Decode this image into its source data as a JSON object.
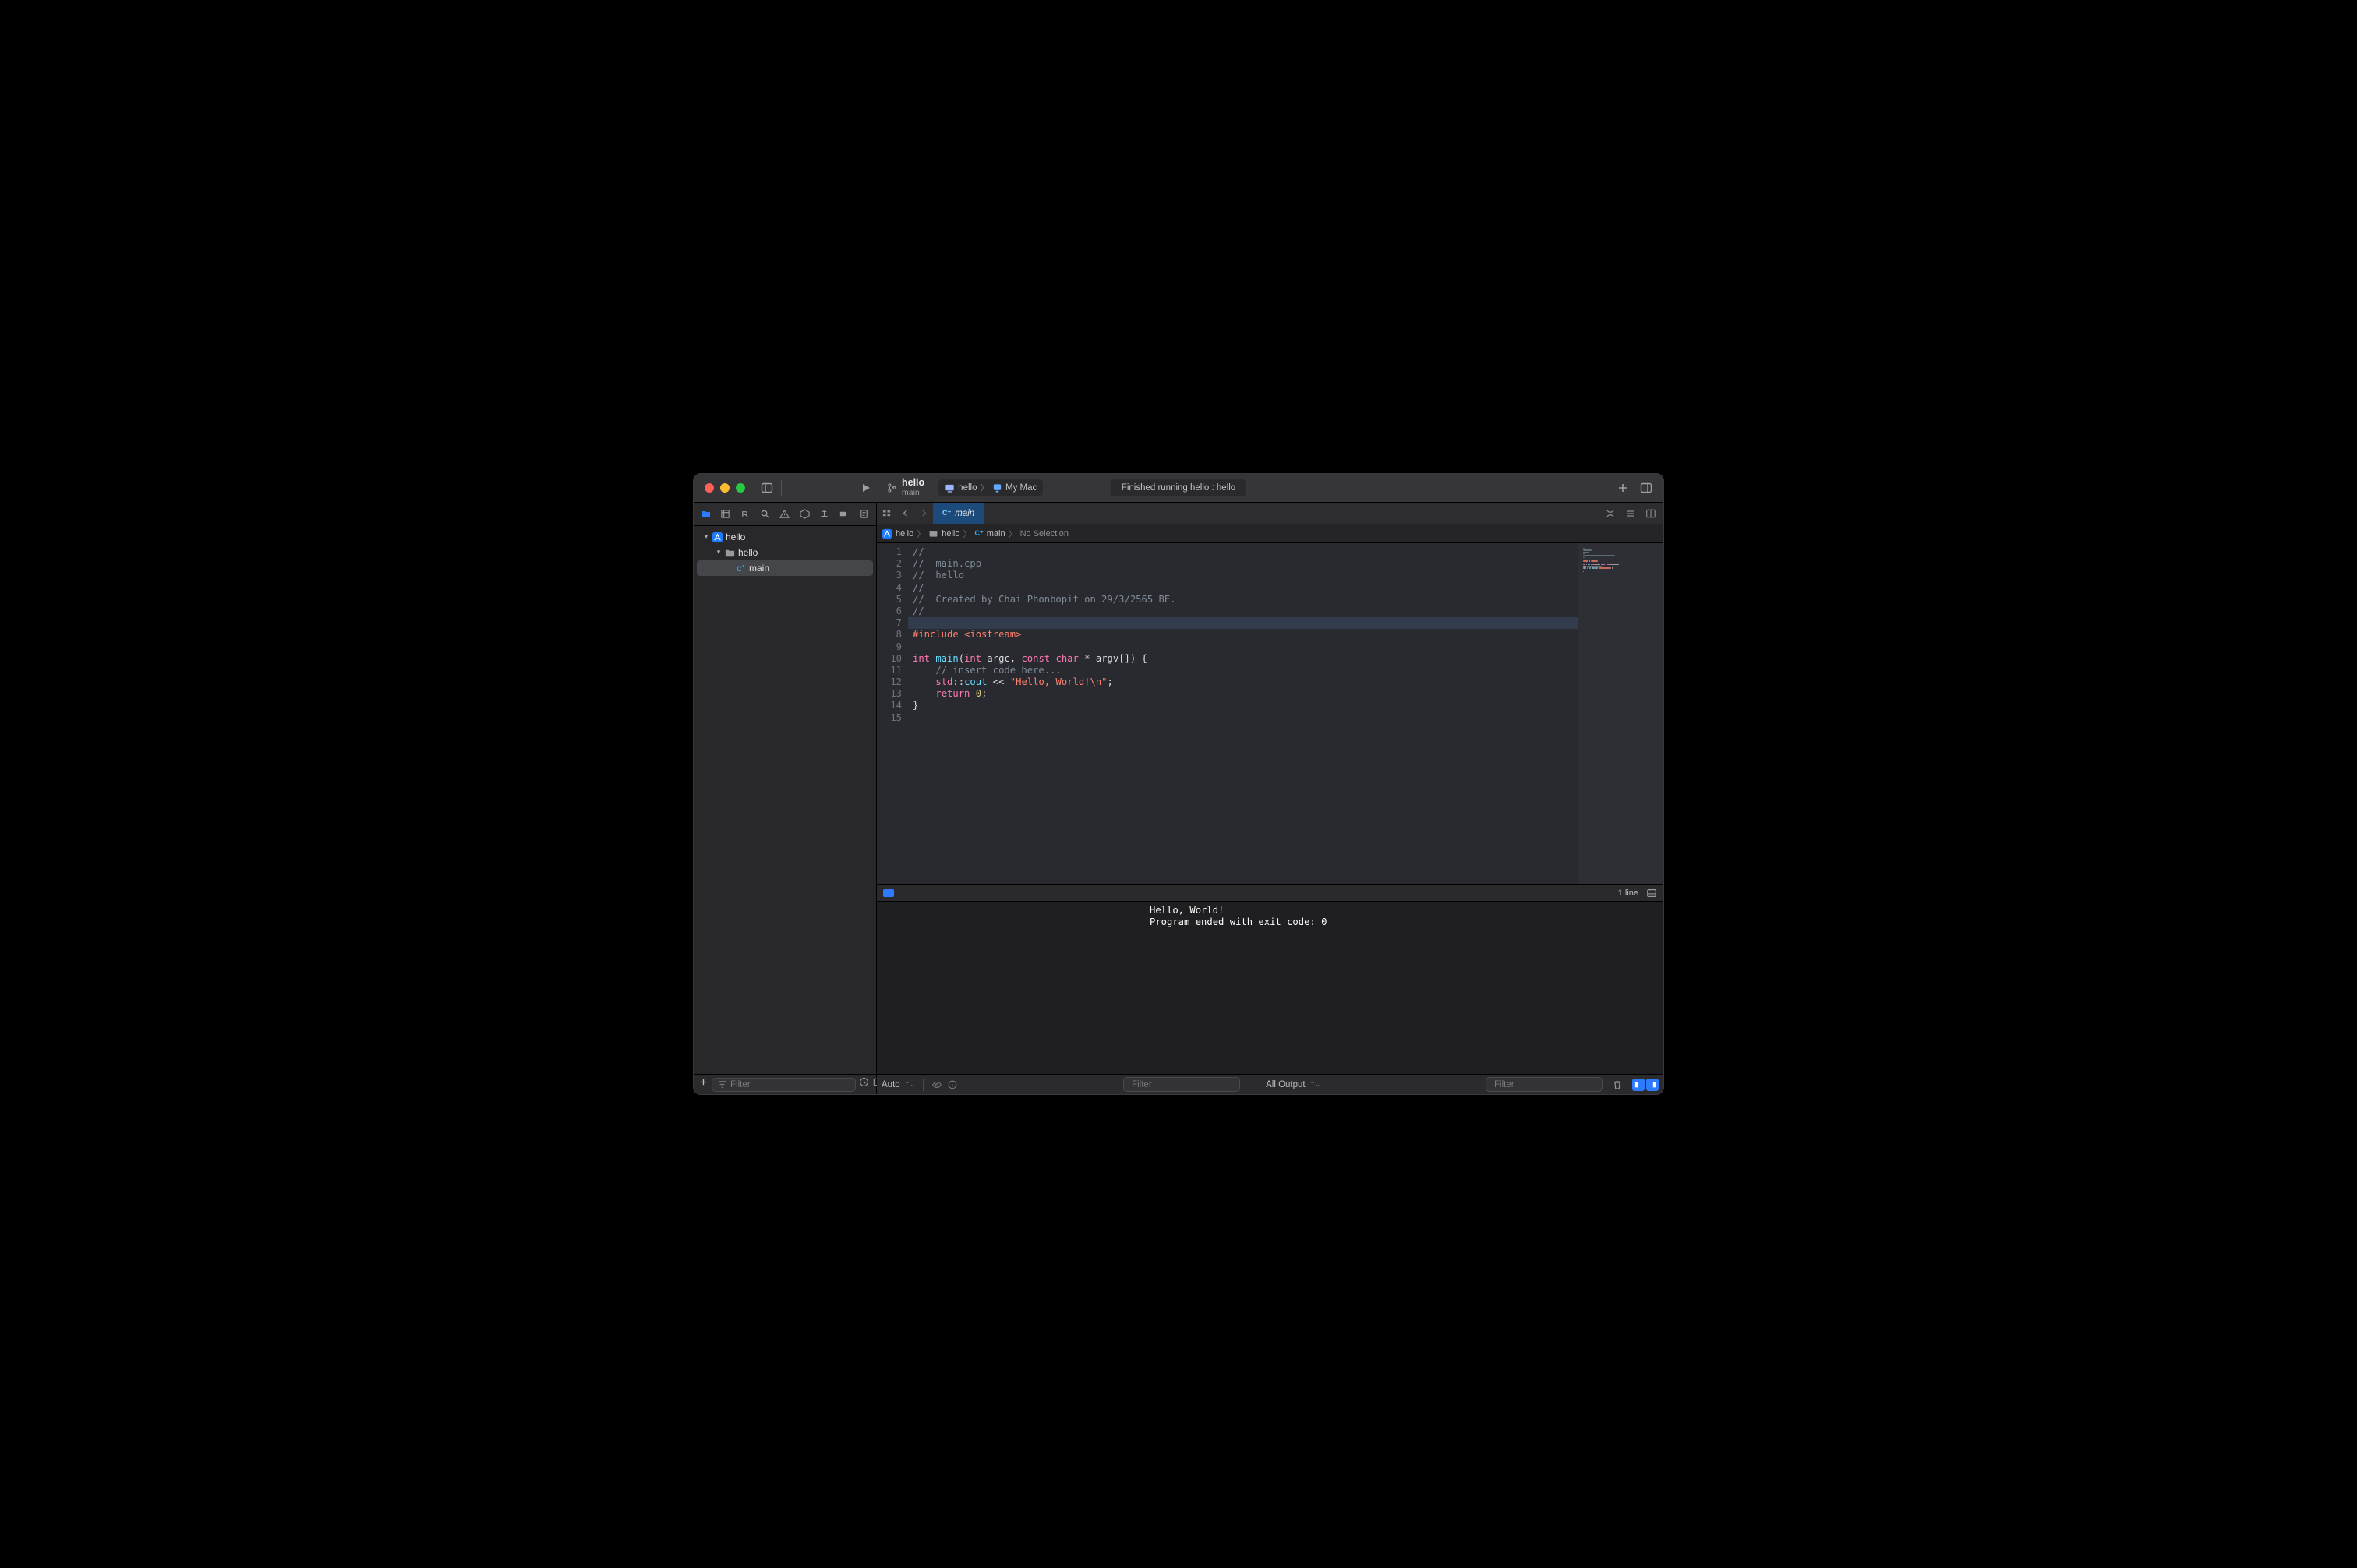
{
  "window": {
    "project_name": "hello",
    "branch": "main",
    "scheme": "hello",
    "destination": "My Mac",
    "status_text": "Finished running hello : hello"
  },
  "navigator": {
    "root": "hello",
    "folder": "hello",
    "file": "main"
  },
  "tab": {
    "file_label": "main"
  },
  "jumpbar": {
    "project": "hello",
    "folder": "hello",
    "file": "main",
    "selection": "No Selection"
  },
  "editor": {
    "highlighted_line": 7,
    "line_count": 15,
    "lines": [
      [
        {
          "c": "t-comment",
          "t": "//"
        }
      ],
      [
        {
          "c": "t-comment",
          "t": "//  main.cpp"
        }
      ],
      [
        {
          "c": "t-comment",
          "t": "//  hello"
        }
      ],
      [
        {
          "c": "t-comment",
          "t": "//"
        }
      ],
      [
        {
          "c": "t-comment",
          "t": "//  Created by Chai Phonbopit on 29/3/2565 BE."
        }
      ],
      [
        {
          "c": "t-comment",
          "t": "//"
        }
      ],
      [],
      [
        {
          "c": "t-preproc",
          "t": "#include"
        },
        {
          "c": "t-plain",
          "t": " "
        },
        {
          "c": "t-angle",
          "t": "<iostream>"
        }
      ],
      [],
      [
        {
          "c": "t-keyword",
          "t": "int"
        },
        {
          "c": "t-plain",
          "t": " "
        },
        {
          "c": "t-func",
          "t": "main"
        },
        {
          "c": "t-plain",
          "t": "("
        },
        {
          "c": "t-keyword",
          "t": "int"
        },
        {
          "c": "t-plain",
          "t": " argc, "
        },
        {
          "c": "t-keyword",
          "t": "const"
        },
        {
          "c": "t-plain",
          "t": " "
        },
        {
          "c": "t-keyword",
          "t": "char"
        },
        {
          "c": "t-plain",
          "t": " * argv[]) {"
        }
      ],
      [
        {
          "c": "t-plain",
          "t": "    "
        },
        {
          "c": "t-comment",
          "t": "// insert code here..."
        }
      ],
      [
        {
          "c": "t-plain",
          "t": "    "
        },
        {
          "c": "t-ns",
          "t": "std"
        },
        {
          "c": "t-plain",
          "t": "::"
        },
        {
          "c": "t-func",
          "t": "cout"
        },
        {
          "c": "t-plain",
          "t": " << "
        },
        {
          "c": "t-string",
          "t": "\"Hello, World!\\n\""
        },
        {
          "c": "t-plain",
          "t": ";"
        }
      ],
      [
        {
          "c": "t-plain",
          "t": "    "
        },
        {
          "c": "t-keyword",
          "t": "return"
        },
        {
          "c": "t-plain",
          "t": " "
        },
        {
          "c": "t-num",
          "t": "0"
        },
        {
          "c": "t-plain",
          "t": ";"
        }
      ],
      [
        {
          "c": "t-plain",
          "t": "}"
        }
      ],
      []
    ]
  },
  "console": {
    "line_info": "1 line",
    "output": "Hello, World!\nProgram ended with exit code: 0"
  },
  "footer": {
    "sidebar_filter_placeholder": "Filter",
    "variables_mode": "Auto",
    "variables_filter_placeholder": "Filter",
    "output_mode": "All Output",
    "console_filter_placeholder": "Filter"
  }
}
